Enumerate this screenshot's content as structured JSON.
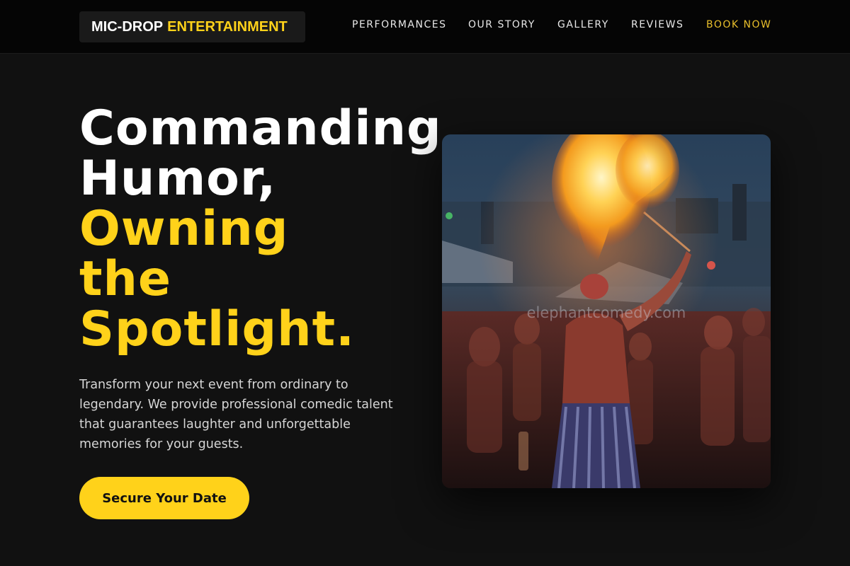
{
  "header": {
    "logo_part1": "MIC-DROP",
    "logo_part2": "ENTERTAINMENT",
    "nav": [
      {
        "label": "PERFORMANCES"
      },
      {
        "label": "OUR STORY"
      },
      {
        "label": "GALLERY"
      },
      {
        "label": "REVIEWS"
      },
      {
        "label": "BOOK NOW"
      }
    ]
  },
  "hero": {
    "title_lines": [
      "Commanding",
      "Humor,",
      "Owning",
      "the",
      "Spotlight."
    ],
    "description": "Transform your next event from ordinary to legendary. We provide professional comedic talent that guarantees laughter and unforgettable memories for your guests.",
    "cta_label": "Secure Your Date",
    "photo_watermark": "elephantcomedy.com"
  },
  "colors": {
    "accent": "#ffd21a",
    "background": "#111111",
    "header_bg": "#050505"
  }
}
